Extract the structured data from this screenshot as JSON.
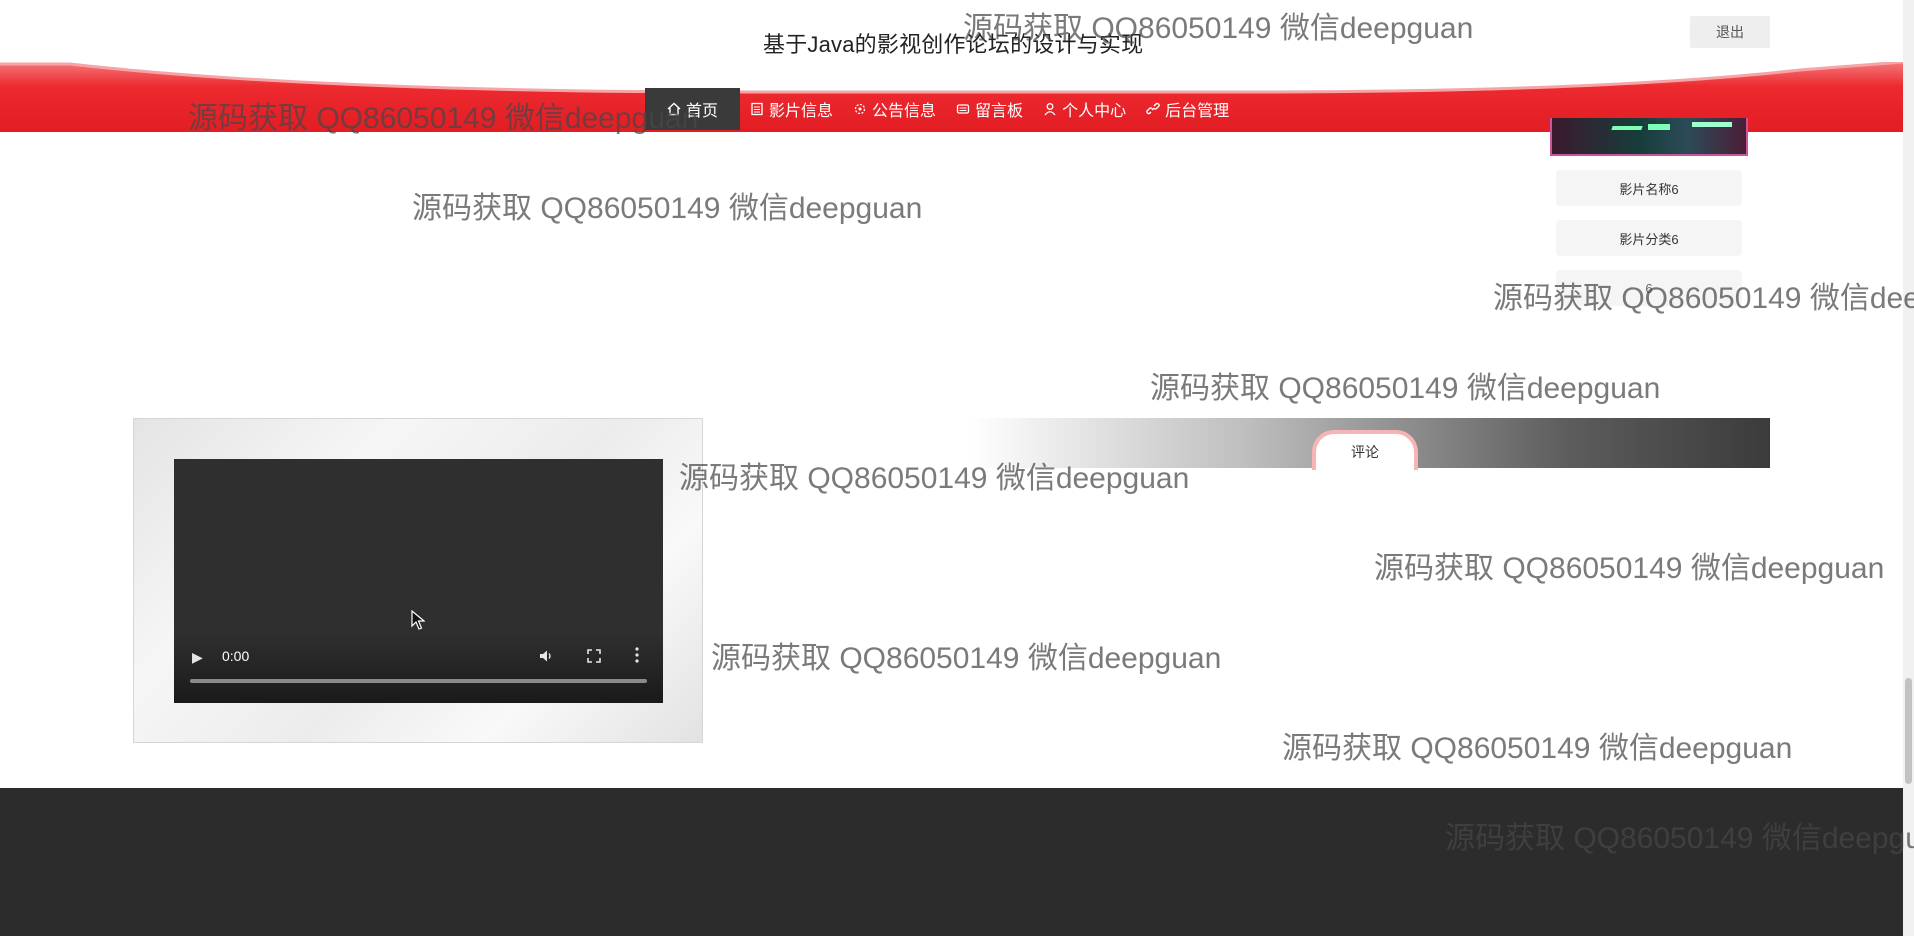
{
  "header": {
    "title": "基于Java的影视创作论坛的设计与实现",
    "logout_label": "退出"
  },
  "nav": {
    "items": [
      {
        "label": "首页",
        "icon": "home-icon",
        "active": true
      },
      {
        "label": "影片信息",
        "icon": "film-info-icon"
      },
      {
        "label": "公告信息",
        "icon": "notice-icon"
      },
      {
        "label": "留言板",
        "icon": "message-icon"
      },
      {
        "label": "个人中心",
        "icon": "user-icon"
      },
      {
        "label": "后台管理",
        "icon": "link-icon"
      }
    ]
  },
  "sidebar": {
    "film_name": "影片名称6",
    "film_category": "影片分类6",
    "third_value": "6"
  },
  "video": {
    "time": "0:00",
    "progress": 0
  },
  "comment": {
    "tab_label": "评论"
  },
  "watermark": {
    "text": "源码获取 QQ86050149 微信deepguan"
  },
  "colors": {
    "nav_red": "#e8232b",
    "nav_active": "#3a3a3a",
    "footer": "#2c2c2c"
  }
}
